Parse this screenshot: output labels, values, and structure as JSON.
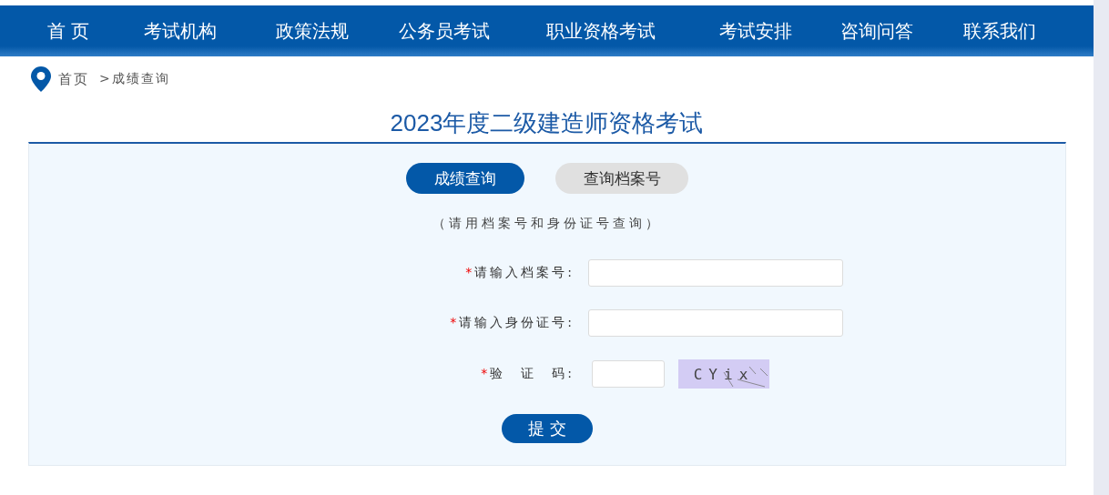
{
  "nav": [
    {
      "label": "首 页"
    },
    {
      "label": "考试机构"
    },
    {
      "label": "政策法规"
    },
    {
      "label": "公务员考试"
    },
    {
      "label": "职业资格考试"
    },
    {
      "label": "考试安排"
    },
    {
      "label": "咨询问答"
    },
    {
      "label": "联系我们"
    }
  ],
  "breadcrumb": {
    "home": "首页",
    "current": ">成绩查询"
  },
  "title": "2023年度二级建造师资格考试",
  "tabs": [
    {
      "label": "成绩查询",
      "selected": true
    },
    {
      "label": "查询档案号",
      "selected": false
    }
  ],
  "hint": "（请用档案号和身份证号查询）",
  "fields": [
    {
      "kind": "text",
      "required_mark": "*",
      "label": "请输入档案号:"
    },
    {
      "kind": "text",
      "required_mark": "*",
      "label": "请输入身份证号:"
    },
    {
      "kind": "captcha",
      "required_mark": "*",
      "label": "验　证　码:",
      "captcha": "CYix"
    }
  ],
  "submit": "提 交"
}
